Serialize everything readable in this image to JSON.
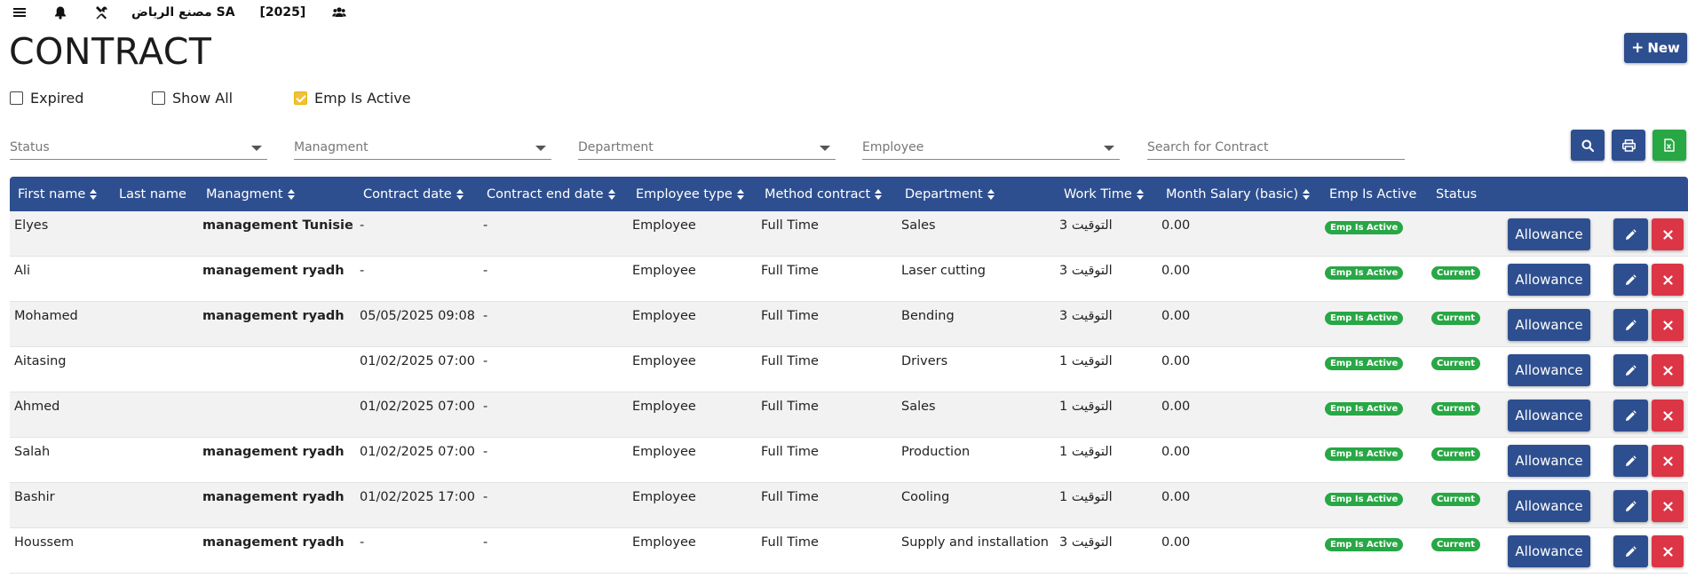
{
  "topbar": {
    "company": "مصنع الرياض SA",
    "year": "[2025]"
  },
  "page": {
    "title": "CONTRACT",
    "new_label": "New"
  },
  "filters": {
    "expired": {
      "label": "Expired",
      "checked": false
    },
    "show_all": {
      "label": "Show All",
      "checked": false
    },
    "emp_is_active": {
      "label": "Emp Is Active",
      "checked": true
    },
    "status_placeholder": "Status",
    "managment_placeholder": "Managment",
    "department_placeholder": "Department",
    "employee_placeholder": "Employee",
    "search_placeholder": "Search for Contract"
  },
  "colors": {
    "primary": "#2e4f8f",
    "success": "#28a745",
    "danger": "#dc3545",
    "checkbox_checked": "#f0c040"
  },
  "table": {
    "headers": {
      "first_name": "First name",
      "last_name": "Last name",
      "managment": "Managment",
      "contract_date": "Contract date",
      "contract_end_date": "Contract end date",
      "employee_type": "Employee type",
      "method_contract": "Method contract",
      "department": "Department",
      "work_time": "Work Time",
      "month_salary": "Month Salary (basic)",
      "emp_is_active": "Emp Is Active",
      "status": "Status"
    },
    "allowance_label": "Allowance",
    "rows": [
      {
        "first_name": "Elyes",
        "last_name": "",
        "managment": "management Tunisie",
        "contract_date": "-",
        "contract_end_date": "-",
        "employee_type": "Employee",
        "method_contract": "Full Time",
        "department": "Sales",
        "work_time": "التوقيت 3",
        "month_salary": "0.00",
        "emp_active_badge": "Emp Is Active",
        "status_badge": ""
      },
      {
        "first_name": "Ali",
        "last_name": "",
        "managment": "management ryadh",
        "contract_date": "-",
        "contract_end_date": "-",
        "employee_type": "Employee",
        "method_contract": "Full Time",
        "department": "Laser cutting",
        "work_time": "التوقيت 3",
        "month_salary": "0.00",
        "emp_active_badge": "Emp Is Active",
        "status_badge": "Current"
      },
      {
        "first_name": "Mohamed",
        "last_name": "",
        "managment": "management ryadh",
        "contract_date": "05/05/2025 09:08",
        "contract_end_date": "-",
        "employee_type": "Employee",
        "method_contract": "Full Time",
        "department": "Bending",
        "work_time": "التوقيت 3",
        "month_salary": "0.00",
        "emp_active_badge": "Emp Is Active",
        "status_badge": "Current"
      },
      {
        "first_name": "Aitasing",
        "last_name": "",
        "managment": "",
        "contract_date": "01/02/2025 07:00",
        "contract_end_date": "-",
        "employee_type": "Employee",
        "method_contract": "Full Time",
        "department": "Drivers",
        "work_time": "التوقيت 1",
        "month_salary": "0.00",
        "emp_active_badge": "Emp Is Active",
        "status_badge": "Current"
      },
      {
        "first_name": "Ahmed",
        "last_name": "",
        "managment": "",
        "contract_date": "01/02/2025 07:00",
        "contract_end_date": "-",
        "employee_type": "Employee",
        "method_contract": "Full Time",
        "department": "Sales",
        "work_time": "التوقيت 1",
        "month_salary": "0.00",
        "emp_active_badge": "Emp Is Active",
        "status_badge": "Current"
      },
      {
        "first_name": "Salah",
        "last_name": "",
        "managment": "management ryadh",
        "contract_date": "01/02/2025 07:00",
        "contract_end_date": "-",
        "employee_type": "Employee",
        "method_contract": "Full Time",
        "department": "Production",
        "work_time": "التوقيت 1",
        "month_salary": "0.00",
        "emp_active_badge": "Emp Is Active",
        "status_badge": "Current"
      },
      {
        "first_name": "Bashir",
        "last_name": "",
        "managment": "management ryadh",
        "contract_date": "01/02/2025 17:00",
        "contract_end_date": "-",
        "employee_type": "Employee",
        "method_contract": "Full Time",
        "department": "Cooling",
        "work_time": "التوقيت 1",
        "month_salary": "0.00",
        "emp_active_badge": "Emp Is Active",
        "status_badge": "Current"
      },
      {
        "first_name": "Houssem",
        "last_name": "",
        "managment": "management ryadh",
        "contract_date": "-",
        "contract_end_date": "-",
        "employee_type": "Employee",
        "method_contract": "Full Time",
        "department": "Supply and installation",
        "work_time": "التوقيت 3",
        "month_salary": "0.00",
        "emp_active_badge": "Emp Is Active",
        "status_badge": "Current"
      }
    ]
  }
}
